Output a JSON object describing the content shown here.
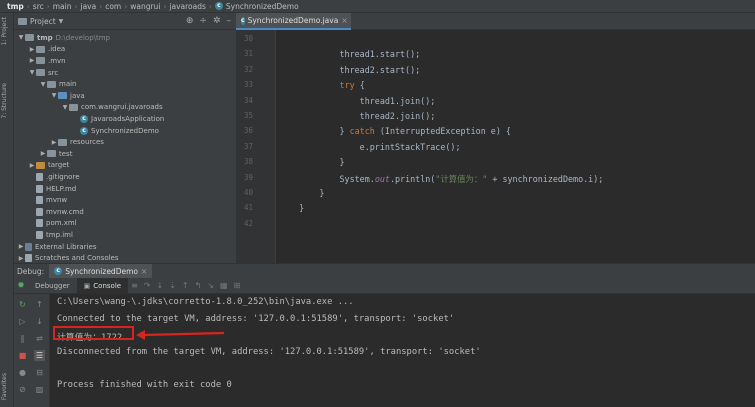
{
  "breadcrumb": [
    "tmp",
    "src",
    "main",
    "java",
    "com",
    "wangrui",
    "javaroads",
    "SynchronizedDemo"
  ],
  "side_tabs": {
    "project": "1: Project",
    "structure": "7: Structure",
    "favorites": "Favorites"
  },
  "project_panel": {
    "title": "Project",
    "tree": [
      {
        "label": "tmp",
        "extra": "D:\\develop\\tmp",
        "level": 0,
        "arrow": "▼",
        "kind": "folder"
      },
      {
        "label": ".idea",
        "level": 1,
        "arrow": "▶",
        "kind": "folder"
      },
      {
        "label": ".mvn",
        "level": 1,
        "arrow": "▶",
        "kind": "folder"
      },
      {
        "label": "src",
        "level": 1,
        "arrow": "▼",
        "kind": "folder"
      },
      {
        "label": "main",
        "level": 2,
        "arrow": "▼",
        "kind": "folder"
      },
      {
        "label": "java",
        "level": 3,
        "arrow": "▼",
        "kind": "folder-blue"
      },
      {
        "label": "com.wangrui.javaroads",
        "level": 4,
        "arrow": "▼",
        "kind": "folder"
      },
      {
        "label": "JavaroadsApplication",
        "level": 5,
        "arrow": "",
        "kind": "class"
      },
      {
        "label": "SynchronizedDemo",
        "level": 5,
        "arrow": "",
        "kind": "class"
      },
      {
        "label": "resources",
        "level": 3,
        "arrow": "▶",
        "kind": "folder"
      },
      {
        "label": "test",
        "level": 2,
        "arrow": "▶",
        "kind": "folder"
      },
      {
        "label": "target",
        "level": 1,
        "arrow": "▶",
        "kind": "folder-orange"
      },
      {
        "label": ".gitignore",
        "level": 1,
        "arrow": "",
        "kind": "file"
      },
      {
        "label": "HELP.md",
        "level": 1,
        "arrow": "",
        "kind": "file"
      },
      {
        "label": "mvnw",
        "level": 1,
        "arrow": "",
        "kind": "file"
      },
      {
        "label": "mvnw.cmd",
        "level": 1,
        "arrow": "",
        "kind": "file"
      },
      {
        "label": "pom.xml",
        "level": 1,
        "arrow": "",
        "kind": "file"
      },
      {
        "label": "tmp.iml",
        "level": 1,
        "arrow": "",
        "kind": "file"
      },
      {
        "label": "External Libraries",
        "level": 0,
        "arrow": "▶",
        "kind": "lib"
      },
      {
        "label": "Scratches and Consoles",
        "level": 0,
        "arrow": "▶",
        "kind": "file"
      }
    ]
  },
  "editor": {
    "tab_label": "SynchronizedDemo.java",
    "lines": [
      {
        "n": "30",
        "parts": []
      },
      {
        "n": "31",
        "parts": [
          {
            "t": "            thread1.start();",
            "c": ""
          }
        ]
      },
      {
        "n": "32",
        "parts": [
          {
            "t": "            thread2.start();",
            "c": ""
          }
        ]
      },
      {
        "n": "33",
        "parts": [
          {
            "t": "            ",
            "c": ""
          },
          {
            "t": "try",
            "c": "kw"
          },
          {
            "t": " {",
            "c": ""
          }
        ]
      },
      {
        "n": "34",
        "parts": [
          {
            "t": "                thread1.join();",
            "c": ""
          }
        ]
      },
      {
        "n": "35",
        "parts": [
          {
            "t": "                thread2.join();",
            "c": ""
          }
        ]
      },
      {
        "n": "36",
        "parts": [
          {
            "t": "            } ",
            "c": ""
          },
          {
            "t": "catch",
            "c": "kw"
          },
          {
            "t": " (InterruptedException e) {",
            "c": ""
          }
        ]
      },
      {
        "n": "37",
        "parts": [
          {
            "t": "                e.printStackTrace();",
            "c": ""
          }
        ]
      },
      {
        "n": "38",
        "parts": [
          {
            "t": "            }",
            "c": ""
          }
        ]
      },
      {
        "n": "39",
        "parts": [
          {
            "t": "            System.",
            "c": ""
          },
          {
            "t": "out",
            "c": "fn"
          },
          {
            "t": ".println(",
            "c": ""
          },
          {
            "t": "\"计算值为：\"",
            "c": "st"
          },
          {
            "t": " + synchronizedDemo.i);",
            "c": ""
          }
        ]
      },
      {
        "n": "40",
        "parts": [
          {
            "t": "        }",
            "c": ""
          }
        ]
      },
      {
        "n": "41",
        "parts": [
          {
            "t": "    }",
            "c": ""
          }
        ]
      },
      {
        "n": "42",
        "parts": []
      }
    ]
  },
  "debug": {
    "label": "Debug:",
    "session": "SynchronizedDemo",
    "tab_debugger": "Debugger",
    "tab_console": "Console"
  },
  "console": {
    "lines": [
      "C:\\Users\\wang-\\.jdks\\corretto-1.8.0_252\\bin\\java.exe ...",
      "Connected to the target VM, address: '127.0.0.1:51589', transport: 'socket'",
      "计算值为：1722",
      "Disconnected from the target VM, address: '127.0.0.1:51589', transport: 'socket'",
      "",
      "Process finished with exit code 0"
    ]
  },
  "colors": {
    "highlight": "#d6241f",
    "accent": "#4a88c7"
  }
}
